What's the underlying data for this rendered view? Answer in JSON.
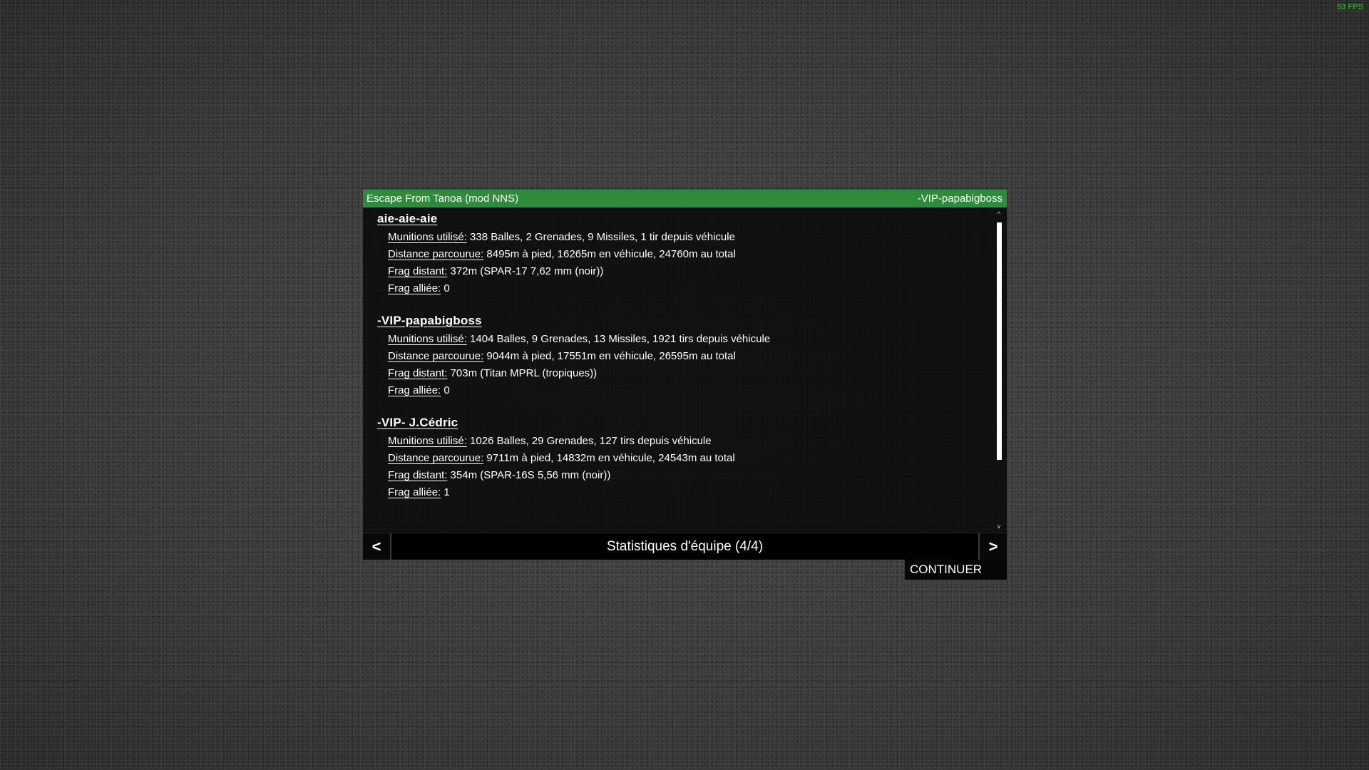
{
  "hud": {
    "fps_text": "53 FPS"
  },
  "dialog": {
    "title_left": "Escape From Tanoa (mod NNS)",
    "title_right": "-VIP-papabigboss",
    "accent_color": "#2f8a3a",
    "players": [
      {
        "name": "aie-aie-aie",
        "stats": [
          {
            "label": "Munitions utilisé:",
            "value": " 338 Balles, 2 Grenades, 9 Missiles, 1 tir depuis véhicule"
          },
          {
            "label": "Distance parcourue:",
            "value": " 8495m à pied, 16265m en véhicule, 24760m au total"
          },
          {
            "label": "Frag distant:",
            "value": " 372m (SPAR-17 7,62 mm (noir))"
          },
          {
            "label": "Frag alliée:",
            "value": " 0"
          }
        ]
      },
      {
        "name": "-VIP-papabigboss",
        "stats": [
          {
            "label": "Munitions utilisé:",
            "value": " 1404 Balles, 9 Grenades, 13 Missiles, 1921 tirs depuis véhicule"
          },
          {
            "label": "Distance parcourue:",
            "value": " 9044m à pied, 17551m en véhicule, 26595m au total"
          },
          {
            "label": "Frag distant:",
            "value": " 703m (Titan MPRL (tropiques))"
          },
          {
            "label": "Frag alliée:",
            "value": " 0"
          }
        ]
      },
      {
        "name": "-VIP- J.Cédric",
        "stats": [
          {
            "label": "Munitions utilisé:",
            "value": " 1026 Balles, 29 Grenades, 127 tirs depuis véhicule"
          },
          {
            "label": "Distance parcourue:",
            "value": " 9711m à pied, 14832m en véhicule, 24543m au total"
          },
          {
            "label": "Frag distant:",
            "value": " 354m (SPAR-16S 5,56 mm (noir))"
          },
          {
            "label": "Frag alliée:",
            "value": " 1"
          }
        ]
      }
    ],
    "scroll": {
      "up_icon": "^",
      "down_icon": "v"
    },
    "nav": {
      "prev_label": "<",
      "next_label": ">",
      "page_title": "Statistiques d'équipe (4/4)"
    },
    "continue_label": "CONTINUER"
  }
}
